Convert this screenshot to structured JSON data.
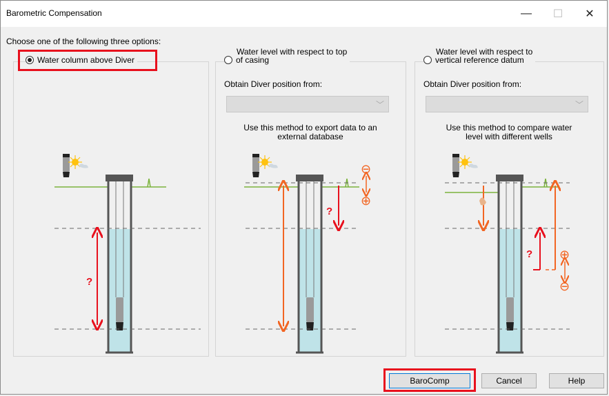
{
  "window": {
    "title": "Barometric Compensation",
    "minimize_glyph": "—",
    "maximize_glyph": "☐",
    "close_glyph": "✕"
  },
  "prompt": "Choose one of the following three options:",
  "options": [
    {
      "label": "Water column above Diver",
      "selected": true
    },
    {
      "label_line1": "Water level with respect to top",
      "label_line2": "of casing",
      "selected": false
    },
    {
      "label_line1": "Water level with respect to",
      "label_line2": "vertical reference datum",
      "selected": false
    }
  ],
  "obtain_label": "Obtain Diver position from:",
  "dropdown_value": "",
  "descriptions": [
    {
      "line1": "Use this method to export data to an",
      "line2": "external database"
    },
    {
      "line1": "Use this method to compare water",
      "line2": "level with different wells"
    }
  ],
  "diagram_marks": {
    "question": "?",
    "minus": "⊖",
    "plus": "⊕"
  },
  "buttons": {
    "barocomp": "BaroComp",
    "cancel": "Cancel",
    "help": "Help"
  },
  "colors": {
    "highlight": "#e8101d",
    "arrow_red": "#e8101d",
    "arrow_orange": "#f26522",
    "water": "#bfe3e8",
    "ground": "#7bb33c",
    "casing": "#555555"
  }
}
